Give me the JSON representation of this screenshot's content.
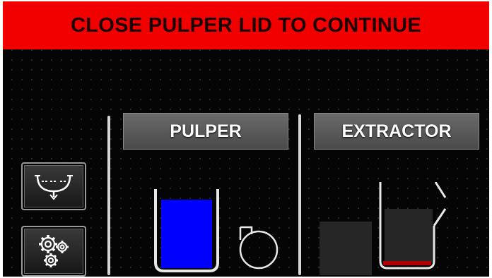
{
  "alert": {
    "message": "CLOSE PULPER LID TO CONTINUE",
    "color": "#f20000"
  },
  "sidebar": {
    "buttons": [
      {
        "icon": "tank-drain-icon"
      },
      {
        "icon": "gears-icon"
      }
    ]
  },
  "tabs": {
    "pulper": {
      "label": "PULPER"
    },
    "extractor": {
      "label": "EXTRACTOR"
    }
  },
  "pulper": {
    "fill_level": 0.9,
    "fill_color": "#0000ff",
    "pump_icon": "pump-icon"
  },
  "extractor": {
    "fill_level": 0.05,
    "fill_color": "#b00000",
    "lid_icon": "lid-open-icon"
  }
}
